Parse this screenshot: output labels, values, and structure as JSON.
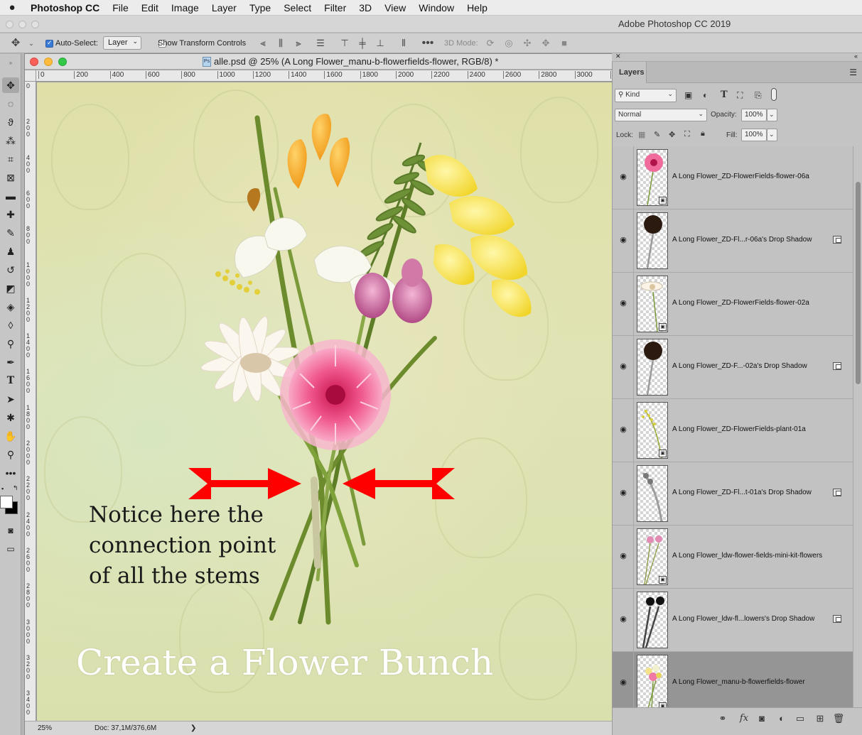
{
  "menubar": {
    "app": "Photoshop CC",
    "items": [
      "File",
      "Edit",
      "Image",
      "Layer",
      "Type",
      "Select",
      "Filter",
      "3D",
      "View",
      "Window",
      "Help"
    ]
  },
  "app_title": "Adobe Photoshop CC 2019",
  "options_bar": {
    "auto_select_label": "Auto-Select:",
    "auto_select_checked": true,
    "auto_select_target": "Layer",
    "show_transform_label": "Show Transform Controls",
    "show_transform_checked": false,
    "mode3d_label": "3D Mode:"
  },
  "document": {
    "title": "alle.psd @ 25% (A Long Flower_manu-b-flowerfields-flower, RGB/8) *",
    "ruler_labels": [
      "0",
      "200",
      "400",
      "600",
      "800",
      "1000",
      "1200",
      "1400",
      "1600",
      "1800",
      "2000",
      "2200",
      "2400",
      "2600",
      "2800",
      "3000",
      "3"
    ],
    "vruler_labels": [
      "0",
      "200",
      "400",
      "600",
      "800",
      "1000",
      "1200",
      "1400",
      "1600",
      "1800",
      "2000",
      "2200",
      "2400",
      "2600",
      "2800",
      "3000",
      "3200",
      "3400"
    ],
    "note_text": "Notice here the\nconnection point\nof all the stems",
    "headline": "Create a Flower Bunch"
  },
  "status": {
    "zoom": "25%",
    "doc_info": "Doc: 37,1M/376,6M",
    "arrow": "❯"
  },
  "layers_panel": {
    "tab": "Layers",
    "filter_kind": "Kind",
    "blend_mode": "Normal",
    "opacity_label": "Opacity:",
    "opacity_value": "100%",
    "lock_label": "Lock:",
    "fill_label": "Fill:",
    "fill_value": "100%",
    "layers": [
      {
        "name": "A Long Flower_ZD-FlowerFields-flower-06a",
        "kind": "smart",
        "thumb": "pink",
        "selected": false
      },
      {
        "name": "A Long Flower_ZD-Fl...r-06a's Drop Shadow",
        "kind": "shadow",
        "thumb": "shadow-flower",
        "selected": false
      },
      {
        "name": "A Long Flower_ZD-FlowerFields-flower-02a",
        "kind": "smart",
        "thumb": "white",
        "selected": false
      },
      {
        "name": "A Long Flower_ZD-F...-02a's Drop Shadow",
        "kind": "shadow",
        "thumb": "shadow-flower",
        "selected": false
      },
      {
        "name": "A Long Flower_ZD-FlowerFields-plant-01a",
        "kind": "smart",
        "thumb": "plant",
        "selected": false
      },
      {
        "name": "A Long Flower_ZD-Fl...t-01a's Drop Shadow",
        "kind": "shadow",
        "thumb": "shadow-plant",
        "selected": false
      },
      {
        "name": "A Long Flower_ldw-flower-fields-mini-kit-flowers",
        "kind": "smart",
        "thumb": "minis",
        "selected": false
      },
      {
        "name": "A Long Flower_ldw-fl...lowers's Drop Shadow",
        "kind": "shadow",
        "thumb": "shadow-minis",
        "selected": false
      },
      {
        "name": "A Long Flower_manu-b-flowerfields-flower",
        "kind": "smart",
        "thumb": "bunch",
        "selected": true
      }
    ]
  },
  "colors": {
    "accent_red": "#ff0000",
    "canvas_bg": "#dfe1ad",
    "selected_layer": "#959595"
  }
}
